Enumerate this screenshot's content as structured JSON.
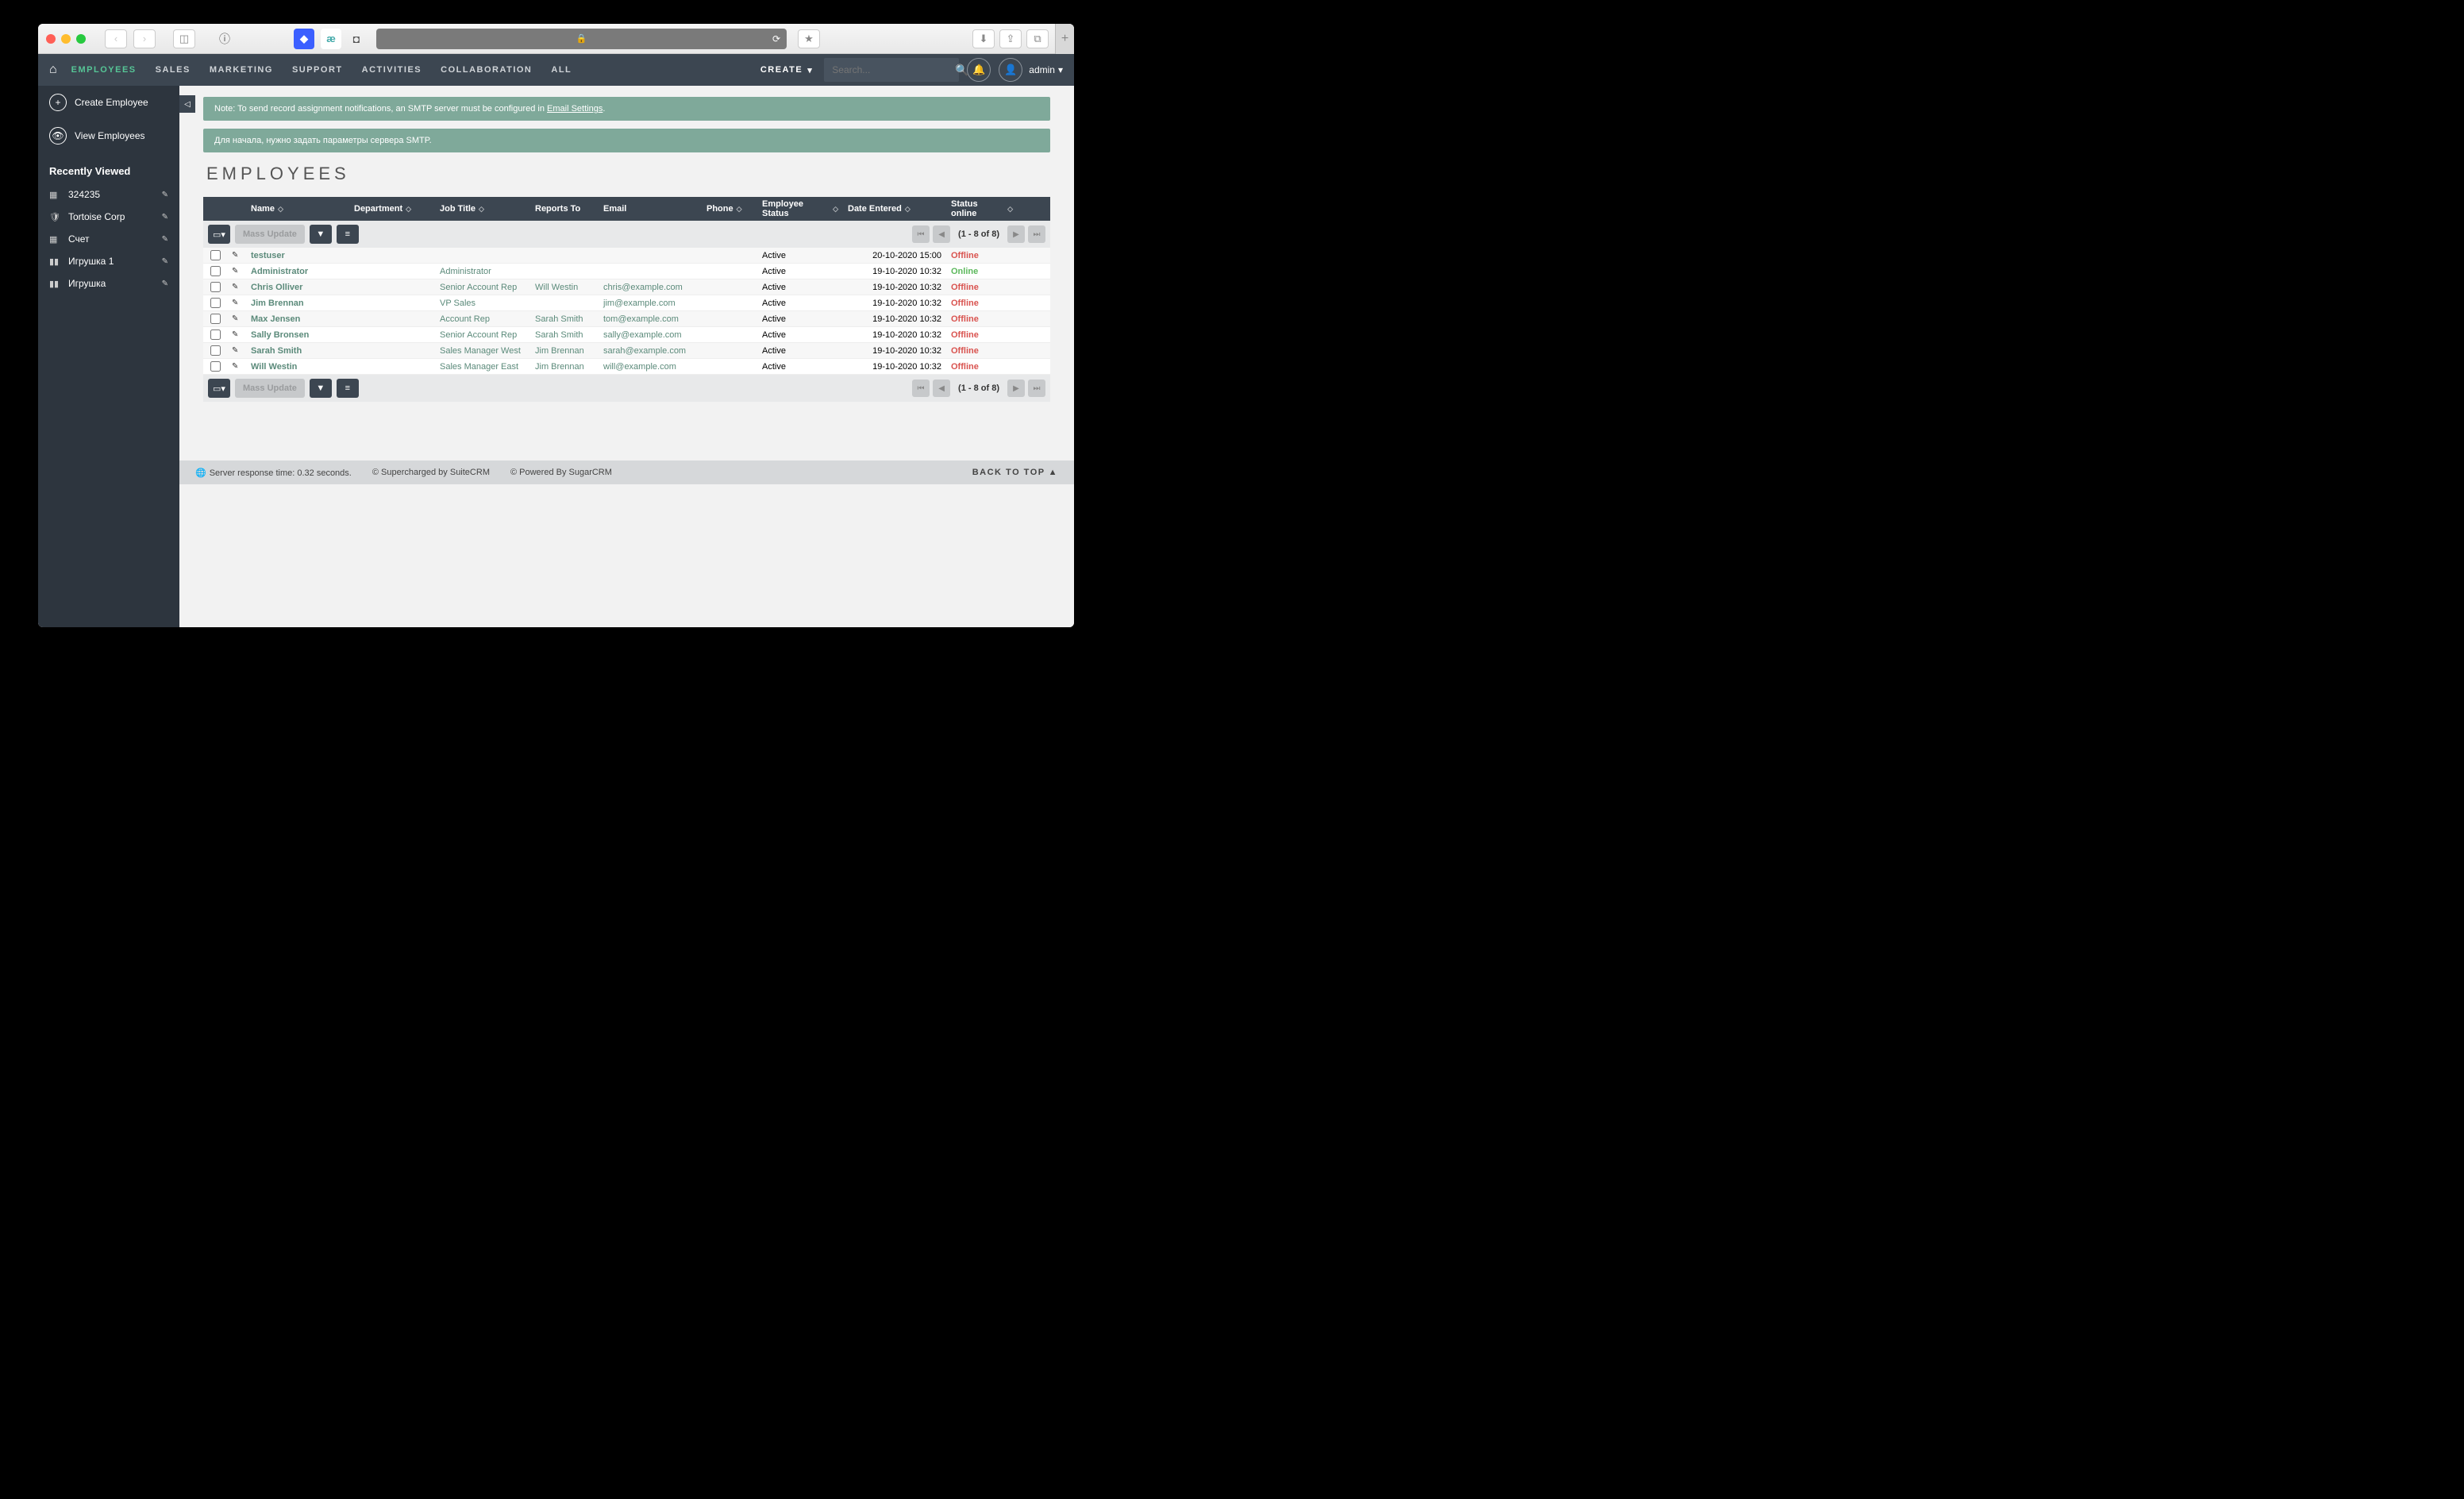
{
  "nav": {
    "items": [
      "EMPLOYEES",
      "SALES",
      "MARKETING",
      "SUPPORT",
      "ACTIVITIES",
      "COLLABORATION",
      "ALL"
    ],
    "active": 0,
    "create": "CREATE",
    "search_placeholder": "Search...",
    "user": "admin"
  },
  "sidebar": {
    "create_label": "Create Employee",
    "view_label": "View Employees",
    "recent_header": "Recently Viewed",
    "recent": [
      {
        "icon": "file",
        "label": "324235"
      },
      {
        "icon": "shield",
        "label": "Tortoise Corp"
      },
      {
        "icon": "file",
        "label": "Счет"
      },
      {
        "icon": "chart",
        "label": "Игрушка 1"
      },
      {
        "icon": "chart",
        "label": "Игрушка"
      }
    ]
  },
  "alerts": {
    "a1_pre": "Note: To send record assignment notifications, an SMTP server must be configured in ",
    "a1_link": "Email Settings",
    "a2": "Для начала, нужно задать параметры сервера SMTP."
  },
  "page_title": "EMPLOYEES",
  "columns": [
    "Name",
    "Department",
    "Job Title",
    "Reports To",
    "Email",
    "Phone",
    "Employee Status",
    "Date Entered",
    "Status online"
  ],
  "toolbar": {
    "mass": "Mass Update",
    "pager": "(1 - 8 of 8)"
  },
  "rows": [
    {
      "name": "testuser",
      "dept": "",
      "job": "",
      "reports": "",
      "email": "",
      "phone": "",
      "status": "Active",
      "date": "20-10-2020 15:00",
      "online": "Offline"
    },
    {
      "name": "Administrator",
      "dept": "",
      "job": "Administrator",
      "reports": "",
      "email": "",
      "phone": "",
      "status": "Active",
      "date": "19-10-2020 10:32",
      "online": "Online"
    },
    {
      "name": "Chris Olliver",
      "dept": "",
      "job": "Senior Account Rep",
      "reports": "Will Westin",
      "email": "chris@example.com",
      "phone": "",
      "status": "Active",
      "date": "19-10-2020 10:32",
      "online": "Offline"
    },
    {
      "name": "Jim Brennan",
      "dept": "",
      "job": "VP Sales",
      "reports": "",
      "email": "jim@example.com",
      "phone": "",
      "status": "Active",
      "date": "19-10-2020 10:32",
      "online": "Offline"
    },
    {
      "name": "Max Jensen",
      "dept": "",
      "job": "Account Rep",
      "reports": "Sarah Smith",
      "email": "tom@example.com",
      "phone": "",
      "status": "Active",
      "date": "19-10-2020 10:32",
      "online": "Offline"
    },
    {
      "name": "Sally Bronsen",
      "dept": "",
      "job": "Senior Account Rep",
      "reports": "Sarah Smith",
      "email": "sally@example.com",
      "phone": "",
      "status": "Active",
      "date": "19-10-2020 10:32",
      "online": "Offline"
    },
    {
      "name": "Sarah Smith",
      "dept": "",
      "job": "Sales Manager West",
      "reports": "Jim Brennan",
      "email": "sarah@example.com",
      "phone": "",
      "status": "Active",
      "date": "19-10-2020 10:32",
      "online": "Offline"
    },
    {
      "name": "Will Westin",
      "dept": "",
      "job": "Sales Manager East",
      "reports": "Jim Brennan",
      "email": "will@example.com",
      "phone": "",
      "status": "Active",
      "date": "19-10-2020 10:32",
      "online": "Offline"
    }
  ],
  "footer": {
    "resp": "Server response time: 0.32 seconds.",
    "s1": "© Supercharged by SuiteCRM",
    "s2": "© Powered By SugarCRM",
    "btt": "BACK TO TOP"
  }
}
